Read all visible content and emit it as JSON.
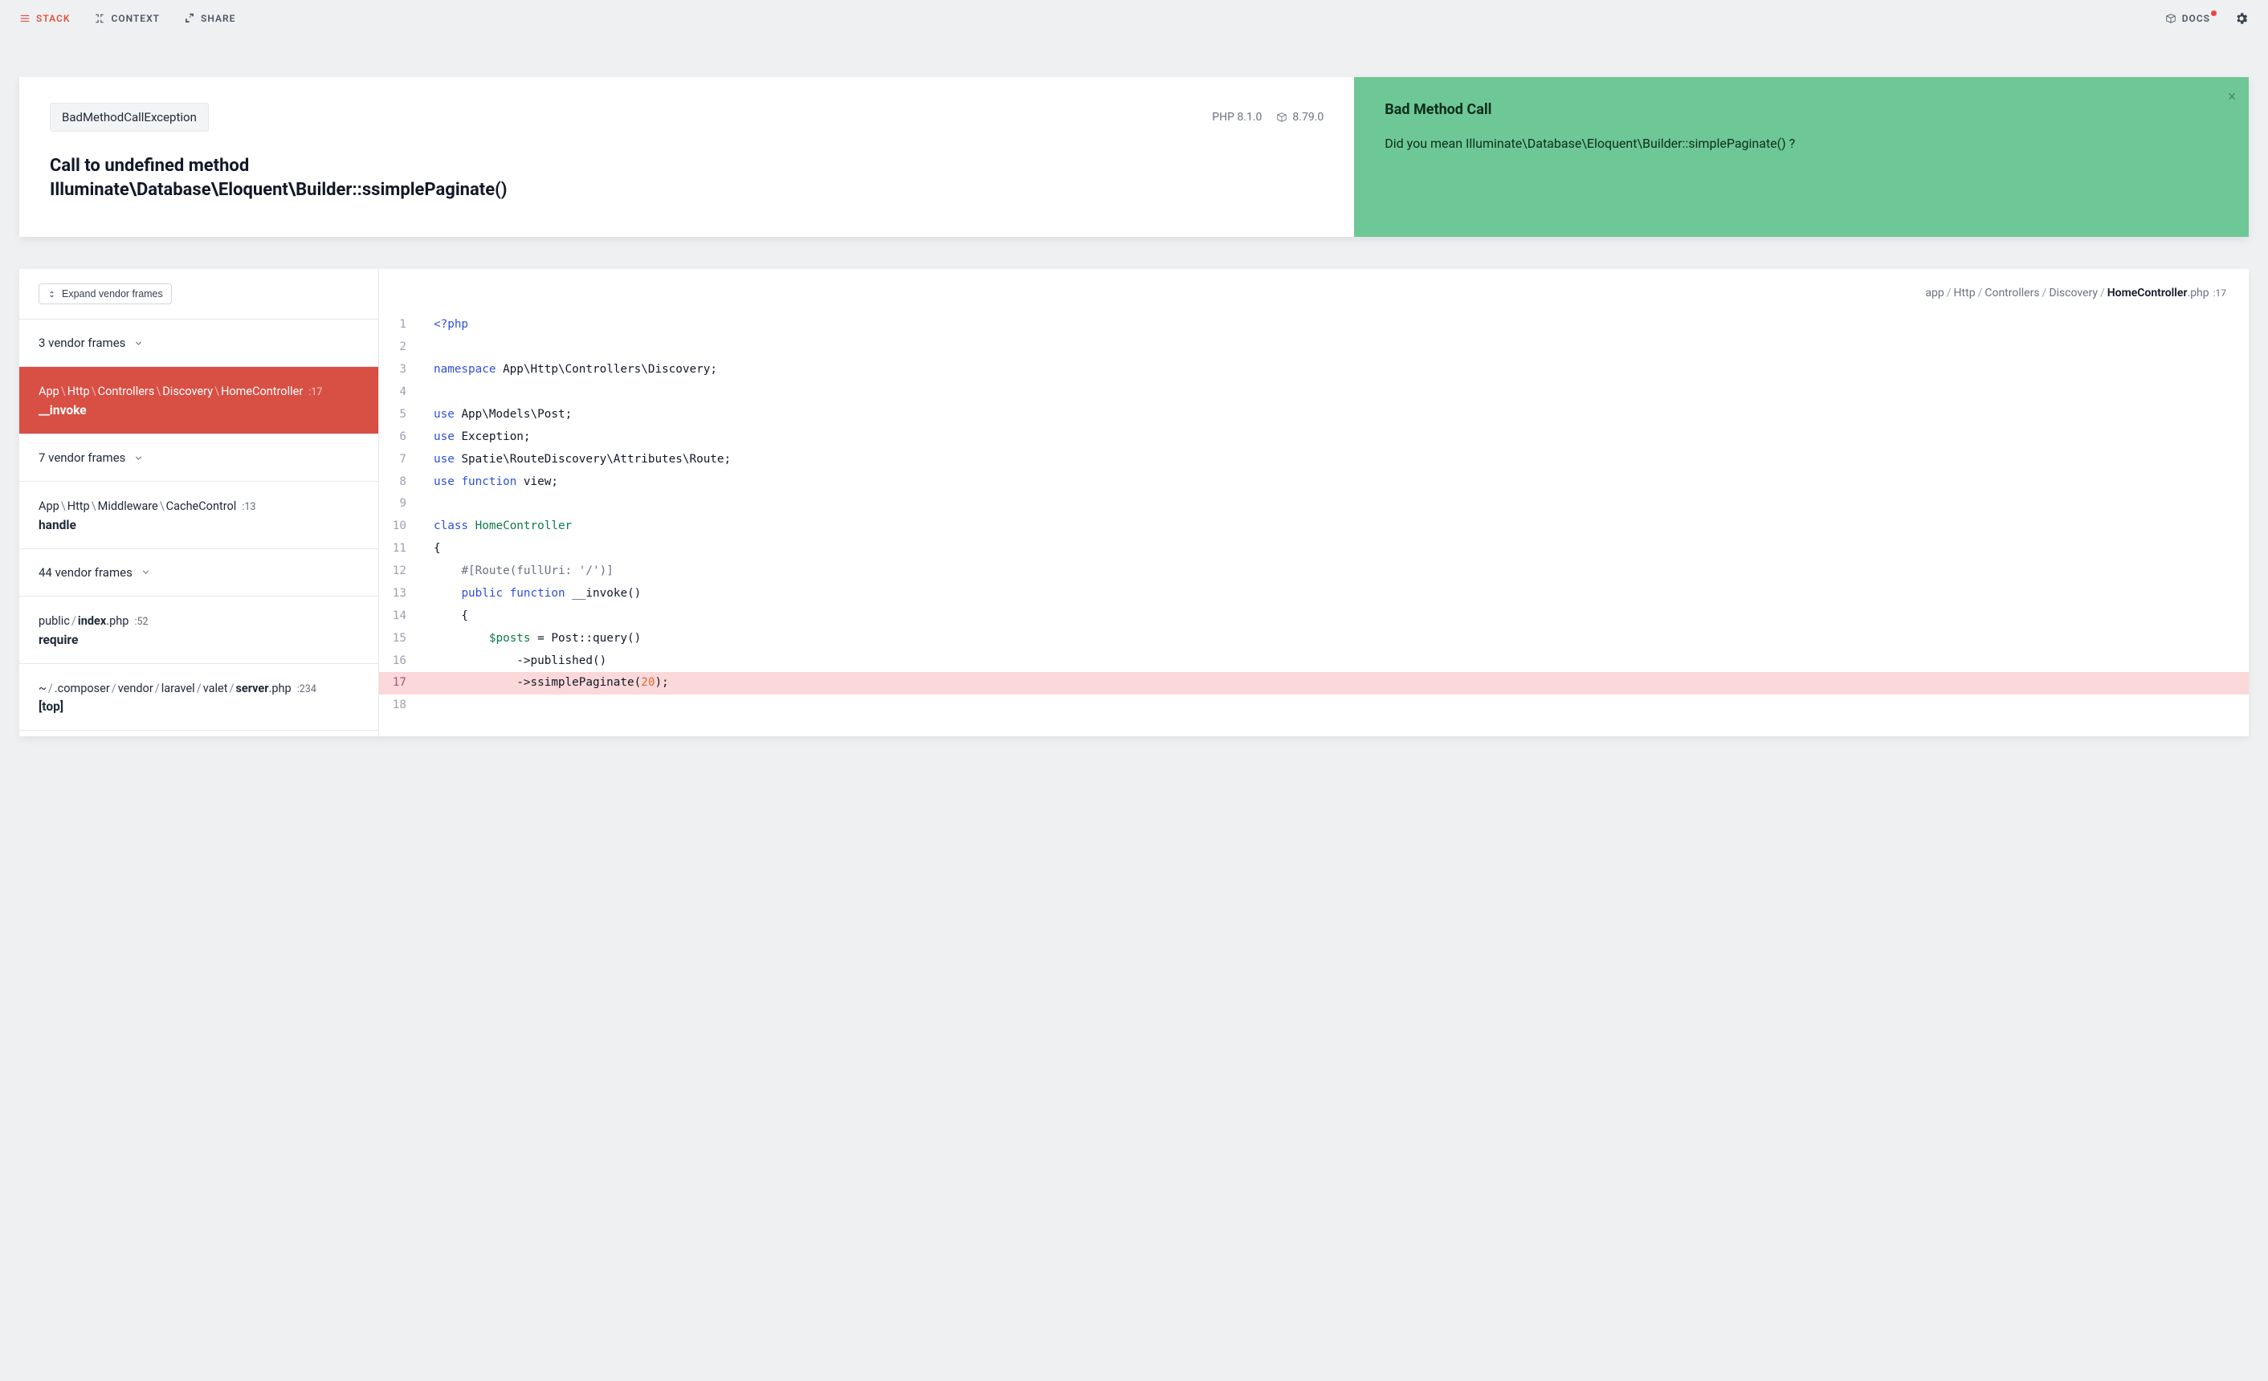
{
  "nav": {
    "stack": "STACK",
    "context": "CONTEXT",
    "share": "SHARE",
    "docs": "DOCS"
  },
  "exception": {
    "class": "BadMethodCallException",
    "php_version": "PHP 8.1.0",
    "laravel_version": "8.79.0",
    "message": "Call to undefined method Illuminate\\Database\\Eloquent\\Builder::ssimplePaginate()"
  },
  "suggestion": {
    "title": "Bad Method Call",
    "body": "Did you mean Illuminate\\Database\\Eloquent\\Builder::simplePaginate() ?"
  },
  "frames": {
    "expand_label": "Expand vendor frames",
    "items": [
      {
        "type": "collapsed",
        "count": 3,
        "label": "3 vendor frames"
      },
      {
        "type": "frame",
        "active": true,
        "segments": [
          "App",
          "Http",
          "Controllers",
          "Discovery",
          "HomeController"
        ],
        "line": 17,
        "method": "__invoke"
      },
      {
        "type": "collapsed",
        "count": 7,
        "label": "7 vendor frames"
      },
      {
        "type": "frame",
        "segments": [
          "App",
          "Http",
          "Middleware",
          "CacheControl"
        ],
        "line": 13,
        "method": "handle"
      },
      {
        "type": "collapsed",
        "count": 44,
        "label": "44 vendor frames"
      },
      {
        "type": "file",
        "pre": "public",
        "bold": "index",
        "post": ".php",
        "line": 52,
        "method": "require"
      },
      {
        "type": "file",
        "pre": "~/.composer/vendor/laravel/valet/",
        "bold": "server",
        "post": ".php",
        "line": 234,
        "method": "[top]"
      }
    ]
  },
  "file_crumb": {
    "segments": [
      "app",
      "Http",
      "Controllers",
      "Discovery"
    ],
    "bold": "HomeController",
    "ext": ".php",
    "line": 17
  },
  "code": {
    "highlight_line": 17,
    "lines": [
      {
        "n": 1,
        "tokens": [
          [
            "tok-tag",
            "<?php"
          ]
        ]
      },
      {
        "n": 2,
        "tokens": []
      },
      {
        "n": 3,
        "tokens": [
          [
            "tok-kw",
            "namespace"
          ],
          [
            "",
            " "
          ],
          [
            "tok-ns",
            "App\\Http\\Controllers\\Discovery"
          ],
          [
            "",
            ";"
          ]
        ]
      },
      {
        "n": 4,
        "tokens": []
      },
      {
        "n": 5,
        "tokens": [
          [
            "tok-kw",
            "use"
          ],
          [
            "",
            " "
          ],
          [
            "tok-ns",
            "App\\Models\\Post"
          ],
          [
            "",
            ";"
          ]
        ]
      },
      {
        "n": 6,
        "tokens": [
          [
            "tok-kw",
            "use"
          ],
          [
            "",
            " "
          ],
          [
            "tok-ns",
            "Exception"
          ],
          [
            "",
            ";"
          ]
        ]
      },
      {
        "n": 7,
        "tokens": [
          [
            "tok-kw",
            "use"
          ],
          [
            "",
            " "
          ],
          [
            "tok-ns",
            "Spatie\\RouteDiscovery\\Attributes\\Route"
          ],
          [
            "",
            ";"
          ]
        ]
      },
      {
        "n": 8,
        "tokens": [
          [
            "tok-kw",
            "use"
          ],
          [
            "",
            " "
          ],
          [
            "tok-kw",
            "function"
          ],
          [
            "",
            " "
          ],
          [
            "tok-ns",
            "view"
          ],
          [
            "",
            ";"
          ]
        ]
      },
      {
        "n": 9,
        "tokens": []
      },
      {
        "n": 10,
        "tokens": [
          [
            "tok-kw",
            "class"
          ],
          [
            "",
            " "
          ],
          [
            "tok-cls",
            "HomeController"
          ]
        ]
      },
      {
        "n": 11,
        "tokens": [
          [
            "",
            "{"
          ]
        ]
      },
      {
        "n": 12,
        "tokens": [
          [
            "",
            "    "
          ],
          [
            "tok-attr",
            "#[Route(fullUri: '/')]"
          ]
        ]
      },
      {
        "n": 13,
        "tokens": [
          [
            "",
            "    "
          ],
          [
            "tok-kw",
            "public"
          ],
          [
            "",
            " "
          ],
          [
            "tok-kw",
            "function"
          ],
          [
            "",
            " "
          ],
          [
            "tok-fn",
            "__invoke"
          ],
          [
            "",
            "()"
          ]
        ]
      },
      {
        "n": 14,
        "tokens": [
          [
            "",
            "    {"
          ]
        ]
      },
      {
        "n": 15,
        "tokens": [
          [
            "",
            "        "
          ],
          [
            "tok-var",
            "$posts"
          ],
          [
            "",
            " = Post::query()"
          ]
        ]
      },
      {
        "n": 16,
        "tokens": [
          [
            "",
            "            ->published()"
          ]
        ]
      },
      {
        "n": 17,
        "tokens": [
          [
            "",
            "            ->ssimplePaginate("
          ],
          [
            "tok-num",
            "20"
          ],
          [
            "",
            ");"
          ]
        ]
      },
      {
        "n": 18,
        "tokens": []
      }
    ]
  }
}
